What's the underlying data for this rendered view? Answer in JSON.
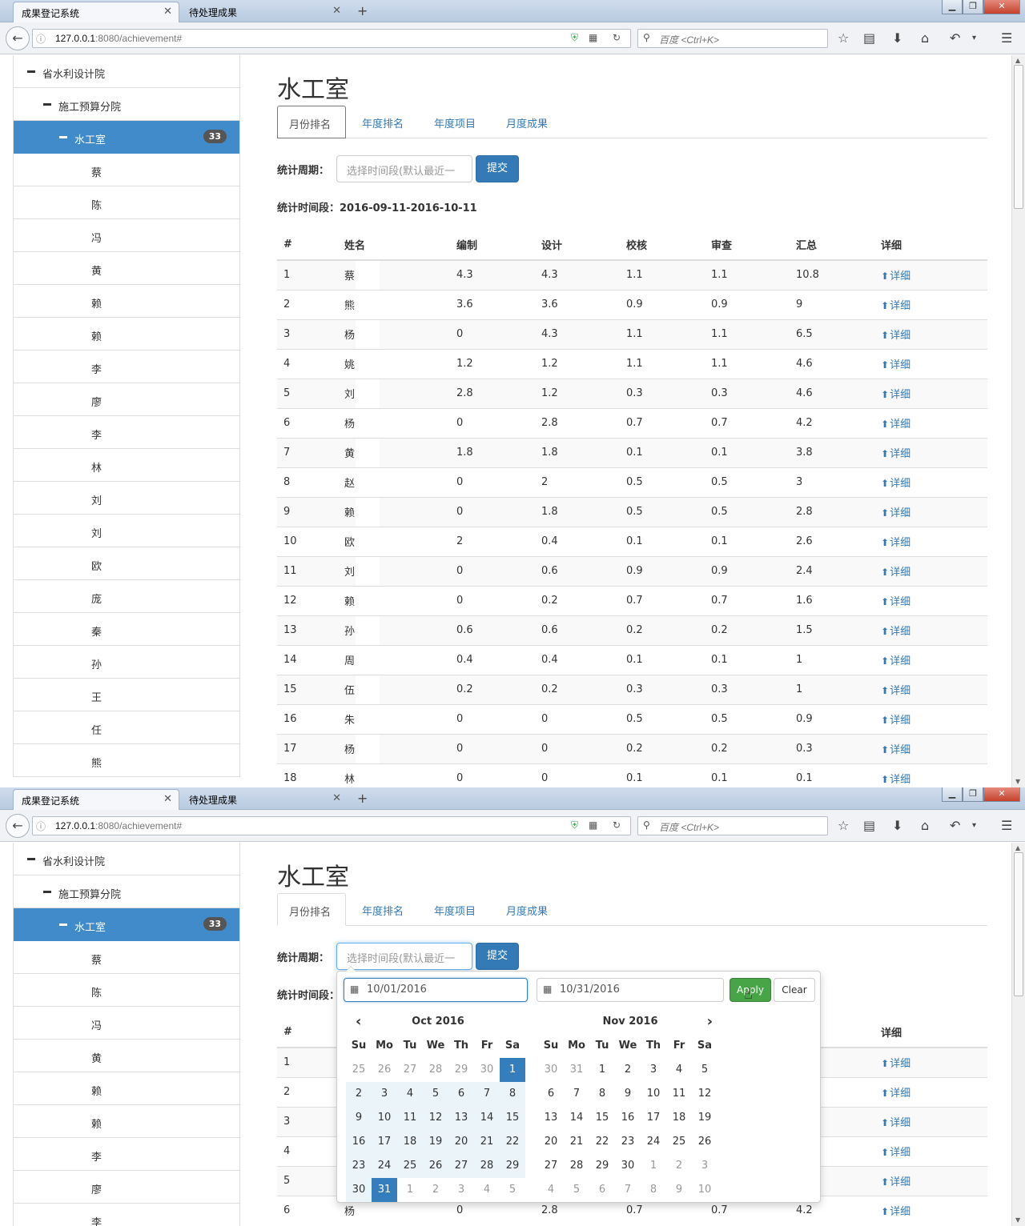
{
  "browser": {
    "tabs": [
      {
        "label": "成果登记系统",
        "active": true
      },
      {
        "label": "待处理成果",
        "active": false
      }
    ],
    "new_tab_glyph": "+",
    "url_host": "127.0.0.1",
    "url_rest": ":8080/achievement#",
    "search_placeholder": "百度 <Ctrl+K>"
  },
  "sidebar": {
    "root": "省水利设计院",
    "branch": "施工预算分院",
    "current": "水工室",
    "current_count": "33",
    "members": [
      "蔡",
      "陈",
      "冯",
      "黄",
      "赖",
      "赖",
      "李",
      "廖",
      "李",
      "林",
      "刘",
      "刘",
      "欧",
      "庞",
      "秦",
      "孙",
      "王",
      "任",
      "熊"
    ]
  },
  "main": {
    "title": "水工室",
    "tabs": [
      "月份排名",
      "年度排名",
      "年度项目",
      "月度成果"
    ],
    "filter_label": "统计周期：",
    "filter_placeholder": "选择时间段(默认最近一",
    "submit": "提交",
    "period_label": "统计时间段：",
    "period_value": "2016-09-11-2016-10-11",
    "columns": [
      "#",
      "姓名",
      "编制",
      "设计",
      "校核",
      "审查",
      "汇总",
      "详细"
    ],
    "detail_label": "详细",
    "rows": [
      [
        "1",
        "蔡",
        "4.3",
        "4.3",
        "1.1",
        "1.1",
        "10.8"
      ],
      [
        "2",
        "熊",
        "3.6",
        "3.6",
        "0.9",
        "0.9",
        "9"
      ],
      [
        "3",
        "杨",
        "0",
        "4.3",
        "1.1",
        "1.1",
        "6.5"
      ],
      [
        "4",
        "姚",
        "1.2",
        "1.2",
        "1.1",
        "1.1",
        "4.6"
      ],
      [
        "5",
        "刘",
        "2.8",
        "1.2",
        "0.3",
        "0.3",
        "4.6"
      ],
      [
        "6",
        "杨",
        "0",
        "2.8",
        "0.7",
        "0.7",
        "4.2"
      ],
      [
        "7",
        "黄",
        "1.8",
        "1.8",
        "0.1",
        "0.1",
        "3.8"
      ],
      [
        "8",
        "赵",
        "0",
        "2",
        "0.5",
        "0.5",
        "3"
      ],
      [
        "9",
        "赖",
        "0",
        "1.8",
        "0.5",
        "0.5",
        "2.8"
      ],
      [
        "10",
        "欧",
        "2",
        "0.4",
        "0.1",
        "0.1",
        "2.6"
      ],
      [
        "11",
        "刘",
        "0",
        "0.6",
        "0.9",
        "0.9",
        "2.4"
      ],
      [
        "12",
        "赖",
        "0",
        "0.2",
        "0.7",
        "0.7",
        "1.6"
      ],
      [
        "13",
        "孙",
        "0.6",
        "0.6",
        "0.2",
        "0.2",
        "1.5"
      ],
      [
        "14",
        "周",
        "0.4",
        "0.4",
        "0.1",
        "0.1",
        "1"
      ],
      [
        "15",
        "伍",
        "0.2",
        "0.2",
        "0.3",
        "0.3",
        "1"
      ],
      [
        "16",
        "朱",
        "0",
        "0",
        "0.5",
        "0.5",
        "0.9"
      ],
      [
        "17",
        "杨",
        "0",
        "0",
        "0.2",
        "0.2",
        "0.3"
      ],
      [
        "18",
        "林",
        "0",
        "0",
        "0.1",
        "0.1",
        "0.1"
      ]
    ]
  },
  "datepicker": {
    "start": "10/01/2016",
    "end": "10/31/2016",
    "apply": "Apply",
    "clear": "Clear",
    "weekdays": [
      "Su",
      "Mo",
      "Tu",
      "We",
      "Th",
      "Fr",
      "Sa"
    ],
    "left_month": "Oct 2016",
    "right_month": "Nov 2016",
    "left_days": [
      "25",
      "26",
      "27",
      "28",
      "29",
      "30",
      "1",
      "2",
      "3",
      "4",
      "5",
      "6",
      "7",
      "8",
      "9",
      "10",
      "11",
      "12",
      "13",
      "14",
      "15",
      "16",
      "17",
      "18",
      "19",
      "20",
      "21",
      "22",
      "23",
      "24",
      "25",
      "26",
      "27",
      "28",
      "29",
      "30",
      "31",
      "1",
      "2",
      "3",
      "4",
      "5"
    ],
    "right_days": [
      "30",
      "31",
      "1",
      "2",
      "3",
      "4",
      "5",
      "6",
      "7",
      "8",
      "9",
      "10",
      "11",
      "12",
      "13",
      "14",
      "15",
      "16",
      "17",
      "18",
      "19",
      "20",
      "21",
      "22",
      "23",
      "24",
      "25",
      "26",
      "27",
      "28",
      "29",
      "30",
      "1",
      "2",
      "3",
      "4",
      "5",
      "6",
      "7",
      "8",
      "9",
      "10"
    ],
    "left_state": [
      "off",
      "off",
      "off",
      "off",
      "off",
      "off",
      "sel",
      "inr",
      "inr",
      "inr",
      "inr",
      "inr",
      "inr",
      "inr",
      "inr",
      "inr",
      "inr",
      "inr",
      "inr",
      "inr",
      "inr",
      "inr",
      "inr",
      "inr",
      "inr",
      "inr",
      "inr",
      "inr",
      "inr",
      "inr",
      "inr",
      "inr",
      "inr",
      "inr",
      "inr",
      "inr",
      "sel",
      "off",
      "off",
      "off",
      "off",
      "off"
    ],
    "right_state": [
      "off",
      "off",
      "",
      "",
      "",
      "",
      "",
      "",
      "",
      "",
      "",
      "",
      "",
      "",
      "",
      "",
      "",
      "",
      "",
      "",
      "",
      "",
      "",
      "",
      "",
      "",
      "",
      "",
      "",
      "",
      "",
      "",
      "off",
      "off",
      "off",
      "off",
      "off",
      "off",
      "off",
      "off",
      "off",
      "off"
    ]
  },
  "colors": {
    "primary": "#337ab7",
    "active_item": "#428bca",
    "apply": "#47a447",
    "badge": "#555555"
  }
}
